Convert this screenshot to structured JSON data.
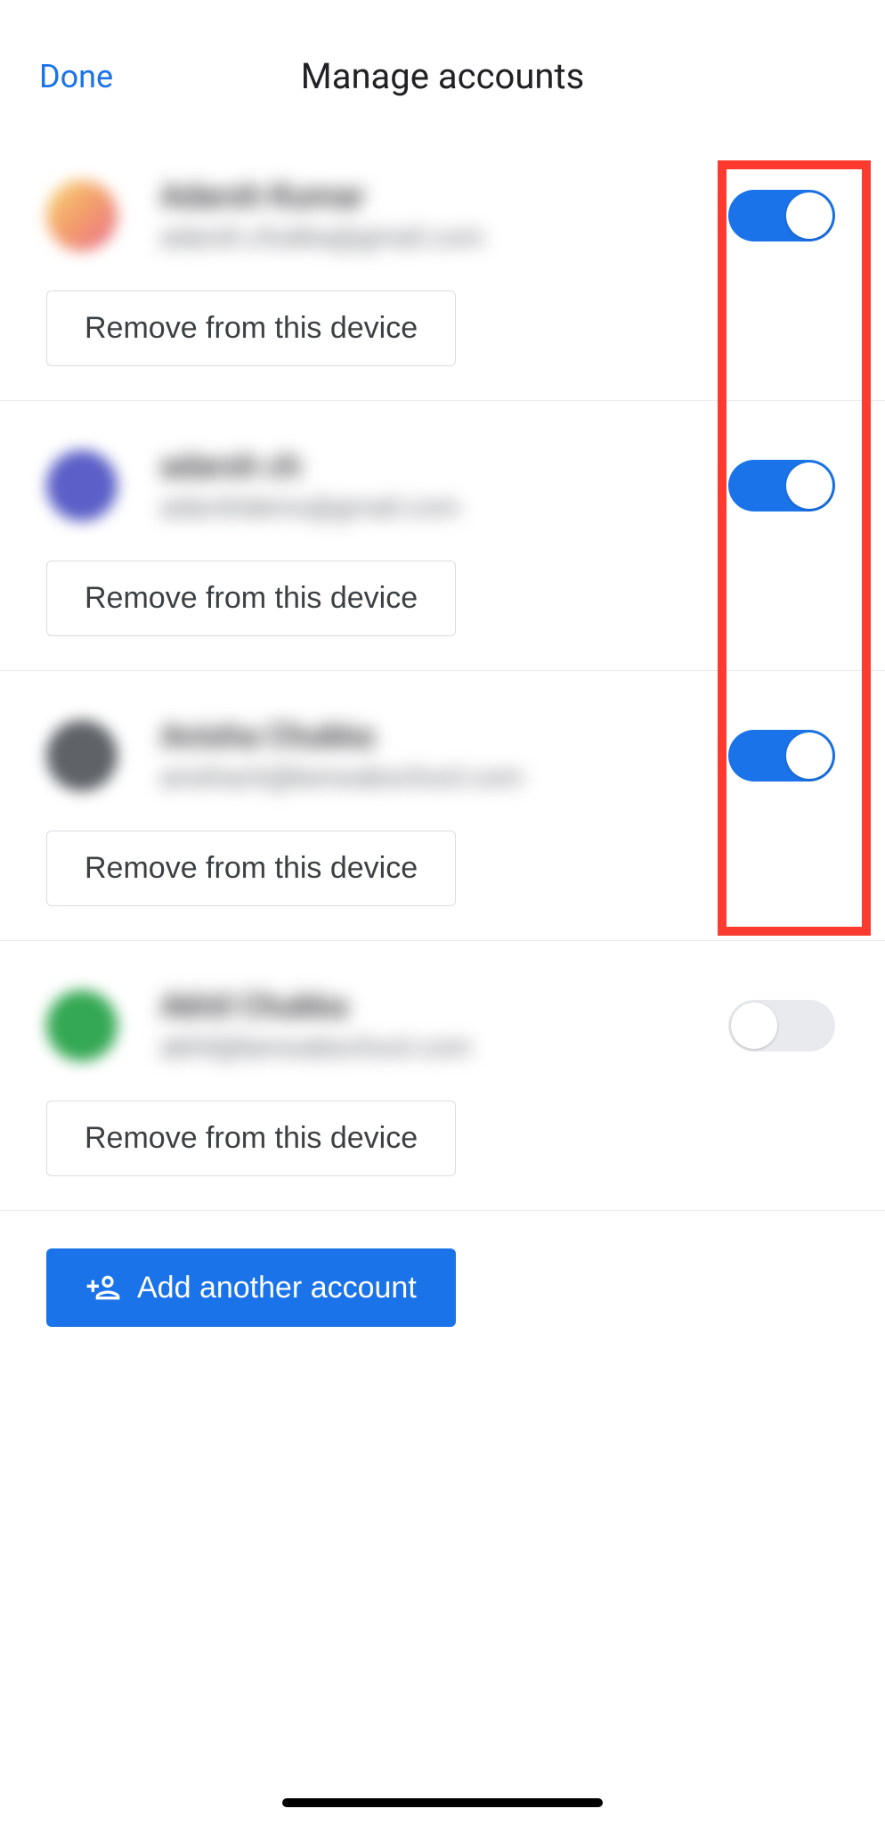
{
  "header": {
    "done_label": "Done",
    "title": "Manage accounts"
  },
  "accounts": [
    {
      "name": "Adarsh Kumar",
      "email": "adarsh.chukka@gmail.com",
      "enabled": true,
      "remove_label": "Remove from this device"
    },
    {
      "name": "adarsh ch",
      "email": "adarshdemo@gmail.com",
      "enabled": true,
      "remove_label": "Remove from this device"
    },
    {
      "name": "Anisha Chukka",
      "email": "anishach@kenwabschool.com",
      "enabled": true,
      "remove_label": "Remove from this device"
    },
    {
      "name": "Akhil Chukka",
      "email": "akhil@kenwabschool.com",
      "enabled": false,
      "remove_label": "Remove from this device"
    }
  ],
  "add_account_label": "Add another account"
}
